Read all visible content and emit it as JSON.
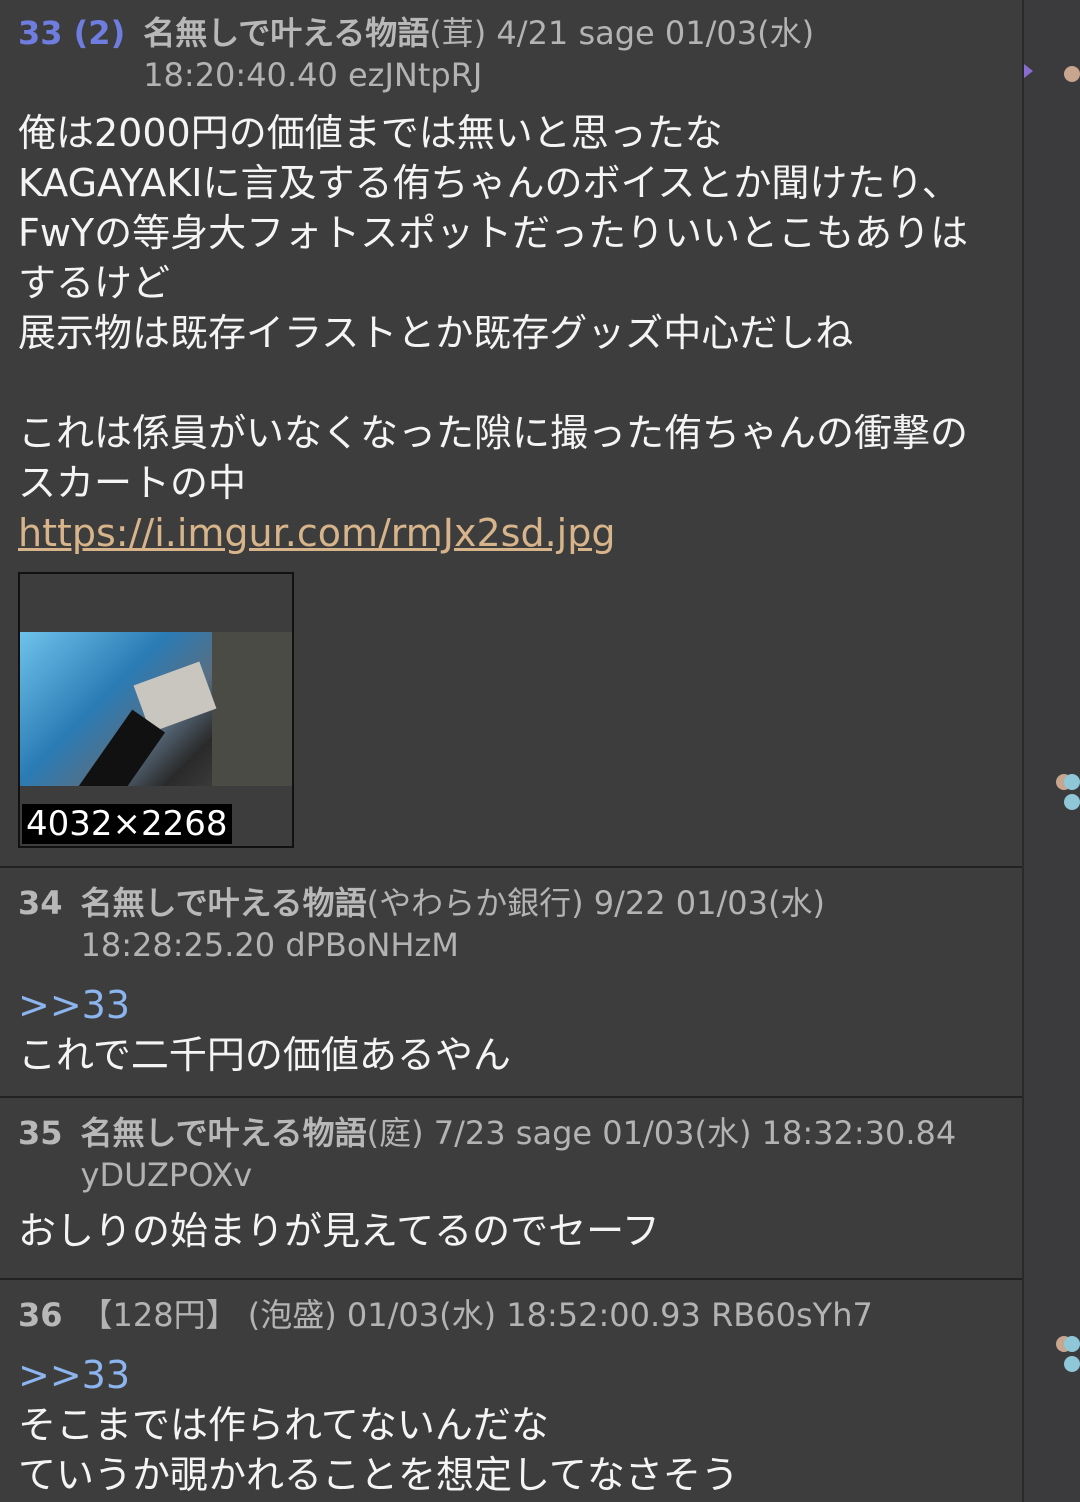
{
  "posts": [
    {
      "number": "33 (2)",
      "name": "名無しで叶える物語",
      "meta_rest": "(茸) 4/21 sage 01/03(水)",
      "meta_line2": "18:20:40.40 ezJNtpRJ",
      "body": "俺は2000円の価値までは無いと思ったな\nKAGAYAKIに言及する侑ちゃんのボイスとか聞けたり、FwYの等身大フォトスポットだったりいいとこもありはするけど\n展示物は既存イラストとか既存グッズ中心だしね\n\nこれは係員がいなくなった隙に撮った侑ちゃんの衝撃のスカートの中",
      "link": "https://i.imgur.com/rmJx2sd.jpg",
      "thumb_caption": "4032×2268"
    },
    {
      "number": "34",
      "name": "名無しで叶える物語",
      "meta_rest": "(やわらか銀行) 9/22  01/03(水)",
      "meta_line2": "18:28:25.20 dPBoNHzM",
      "anchor": ">>33",
      "body": "これで二千円の価値あるやん"
    },
    {
      "number": "35",
      "name": "名無しで叶える物語",
      "meta_rest": "(庭) 7/23 sage 01/03(水) 18:32:30.84",
      "meta_line2": "yDUZPOXv",
      "body": "おしりの始まりが見えてるのでセーフ"
    },
    {
      "number": "36",
      "name": "",
      "meta_rest": "【128円】 (泡盛)  01/03(水) 18:52:00.93 RB60sYh7",
      "anchor": ">>33",
      "body": "そこまでは作られてないんだな\nていうか覗かれることを想定してなさそう"
    }
  ],
  "colors": {
    "background": "#3d3d3d",
    "post_number_highlight": "#6f7de0",
    "anchor": "#8cb4ee",
    "link": "#d7b48a"
  }
}
